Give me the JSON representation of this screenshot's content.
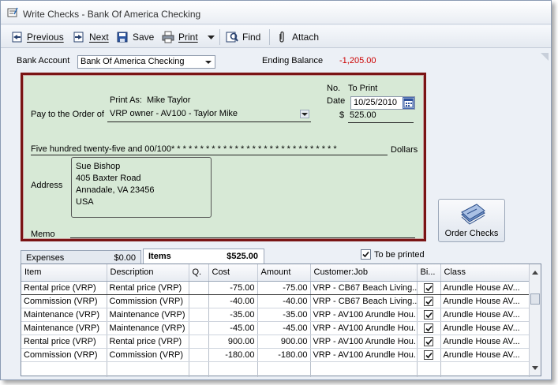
{
  "window": {
    "title": "Write Checks - Bank Of America Checking"
  },
  "toolbar": {
    "previous": "Previous",
    "next": "Next",
    "save": "Save",
    "print": "Print",
    "find": "Find",
    "attach": "Attach"
  },
  "header": {
    "bank_account_label": "Bank Account",
    "bank_account_value": "Bank Of America Checking",
    "ending_balance_label": "Ending Balance",
    "ending_balance_value": "-1,205.00"
  },
  "check": {
    "no_label": "No.",
    "no_value": "To Print",
    "date_label": "Date",
    "date_value": "10/25/2010",
    "print_as_label": "Print As:",
    "print_as_value": "Mike Taylor",
    "pay_to_label": "Pay to the Order of",
    "payee": "VRP owner - AV100 - Taylor Mike",
    "dollar_sign": "$",
    "amount": "525.00",
    "amount_words": "Five hundred twenty-five and 00/100* * * * * * * * * * * * * * * * * * * * * * * * * * * * *",
    "dollars_label": "Dollars",
    "address_label": "Address",
    "address_lines": {
      "line1": "Sue Bishop",
      "line2": "405 Baxter Road",
      "line3": "Annadale, VA 23456",
      "line4": "USA"
    },
    "memo_label": "Memo"
  },
  "order_checks": {
    "label": "Order Checks"
  },
  "tabs": {
    "expenses": {
      "label": "Expenses",
      "amount": "$0.00"
    },
    "items": {
      "label": "Items",
      "amount": "$525.00"
    }
  },
  "to_be_printed": {
    "label": "To be printed",
    "checked": true
  },
  "grid": {
    "columns": {
      "item": "Item",
      "description": "Description",
      "qty": "Q.",
      "cost": "Cost",
      "amount": "Amount",
      "customer_job": "Customer:Job",
      "billable": "Bi...",
      "class": "Class"
    },
    "rows": [
      {
        "item": "Rental price (VRP)",
        "description": "Rental price (VRP)",
        "qty": "",
        "cost": "-75.00",
        "amount": "-75.00",
        "customer_job": "VRP - CB67 Beach Living...",
        "billable": true,
        "class": "Arundle House AV..."
      },
      {
        "item": "Commission (VRP)",
        "description": "Commission (VRP)",
        "qty": "",
        "cost": "-40.00",
        "amount": "-40.00",
        "customer_job": "VRP - CB67 Beach Living...",
        "billable": true,
        "class": "Arundle House AV..."
      },
      {
        "item": "Maintenance (VRP)",
        "description": "Maintenance (VRP)",
        "qty": "",
        "cost": "-35.00",
        "amount": "-35.00",
        "customer_job": "VRP - AV100 Arundle Hou...",
        "billable": true,
        "class": "Arundle House AV..."
      },
      {
        "item": "Maintenance (VRP)",
        "description": "Maintenance (VRP)",
        "qty": "",
        "cost": "-45.00",
        "amount": "-45.00",
        "customer_job": "VRP - AV100 Arundle Hou...",
        "billable": true,
        "class": "Arundle House AV..."
      },
      {
        "item": "Rental price (VRP)",
        "description": "Rental price (VRP)",
        "qty": "",
        "cost": "900.00",
        "amount": "900.00",
        "customer_job": "VRP - AV100 Arundle Hou...",
        "billable": true,
        "class": "Arundle House AV..."
      },
      {
        "item": "Commission (VRP)",
        "description": "Commission (VRP)",
        "qty": "",
        "cost": "-180.00",
        "amount": "-180.00",
        "customer_job": "VRP - AV100 Arundle Hou...",
        "billable": true,
        "class": "Arundle House AV..."
      }
    ]
  },
  "colors": {
    "check_background": "#d7e9d6",
    "check_border": "#7a1414",
    "negative_balance": "#cc0000"
  },
  "icons": {
    "title": "checkbook-icon",
    "previous": "previous-arrow-icon",
    "next": "next-arrow-icon",
    "save": "floppy-disk-icon",
    "print": "printer-icon",
    "find": "find-icon",
    "attach": "paperclip-icon",
    "calendar": "calendar-icon",
    "order_checks": "checkbook-stack-icon"
  }
}
